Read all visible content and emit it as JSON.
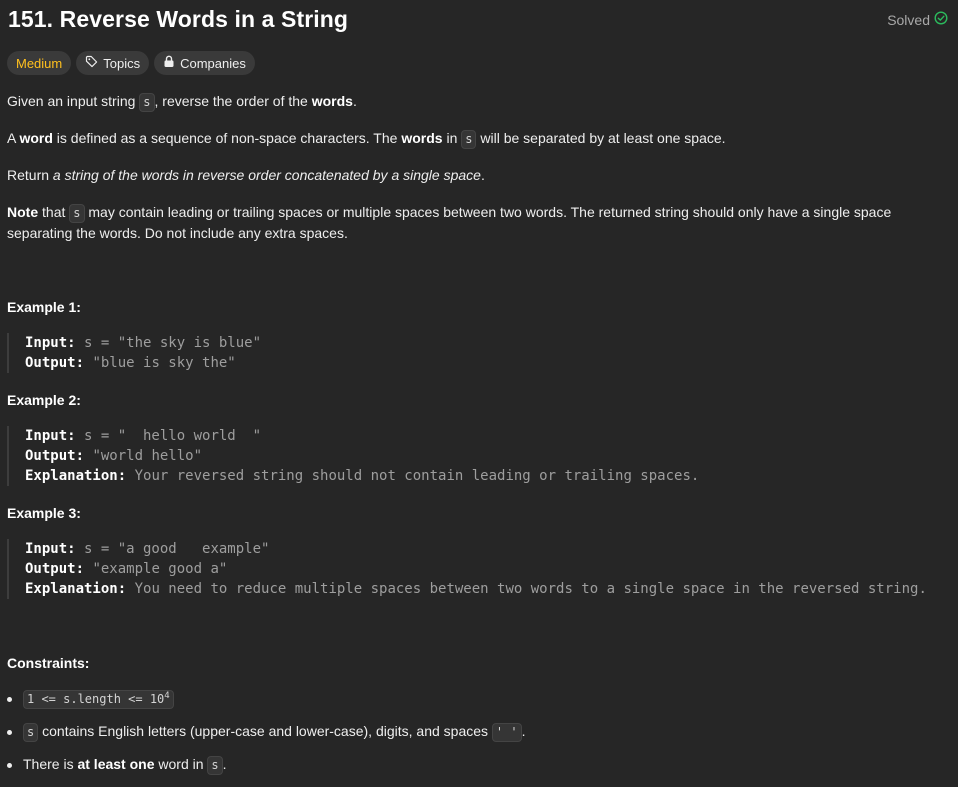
{
  "header": {
    "title": "151. Reverse Words in a String",
    "status": "Solved",
    "status_color": "#2cbb5d"
  },
  "tags": {
    "difficulty": "Medium",
    "topics": "Topics",
    "companies": "Companies"
  },
  "description": {
    "p1_a": "Given an input string ",
    "p1_code": "s",
    "p1_b": ", reverse the order of the ",
    "p1_bold": "words",
    "p1_c": ".",
    "p2_a": "A ",
    "p2_bold1": "word",
    "p2_b": " is defined as a sequence of non-space characters. The ",
    "p2_bold2": "words",
    "p2_c": " in ",
    "p2_code": "s",
    "p2_d": " will be separated by at least one space.",
    "p3_a": "Return ",
    "p3_italic": "a string of the words in reverse order concatenated by a single space",
    "p3_b": ".",
    "p4_bold": "Note",
    "p4_a": " that ",
    "p4_code": "s",
    "p4_b": " may contain leading or trailing spaces or multiple spaces between two words. The returned string should only have a single space separating the words. Do not include any extra spaces."
  },
  "examples": [
    {
      "title": "Example 1:",
      "input_label": "Input:",
      "input": " s = \"the sky is blue\"",
      "output_label": "Output:",
      "output": " \"blue is sky the\""
    },
    {
      "title": "Example 2:",
      "input_label": "Input:",
      "input": " s = \"  hello world  \"",
      "output_label": "Output:",
      "output": " \"world hello\"",
      "explanation_label": "Explanation:",
      "explanation": " Your reversed string should not contain leading or trailing spaces."
    },
    {
      "title": "Example 3:",
      "input_label": "Input:",
      "input": " s = \"a good   example\"",
      "output_label": "Output:",
      "output": " \"example good a\"",
      "explanation_label": "Explanation:",
      "explanation": " You need to reduce multiple spaces between two words to a single space in the reversed string."
    }
  ],
  "constraints": {
    "title": "Constraints:",
    "c1_code": "1 <= s.length <= 10",
    "c1_sup": "4",
    "c2_code": "s",
    "c2_text": " contains English letters (upper-case and lower-case), digits, and spaces ",
    "c2_code2": "' '",
    "c2_end": ".",
    "c3_a": "There is ",
    "c3_bold": "at least one",
    "c3_b": " word in ",
    "c3_code": "s",
    "c3_end": "."
  }
}
